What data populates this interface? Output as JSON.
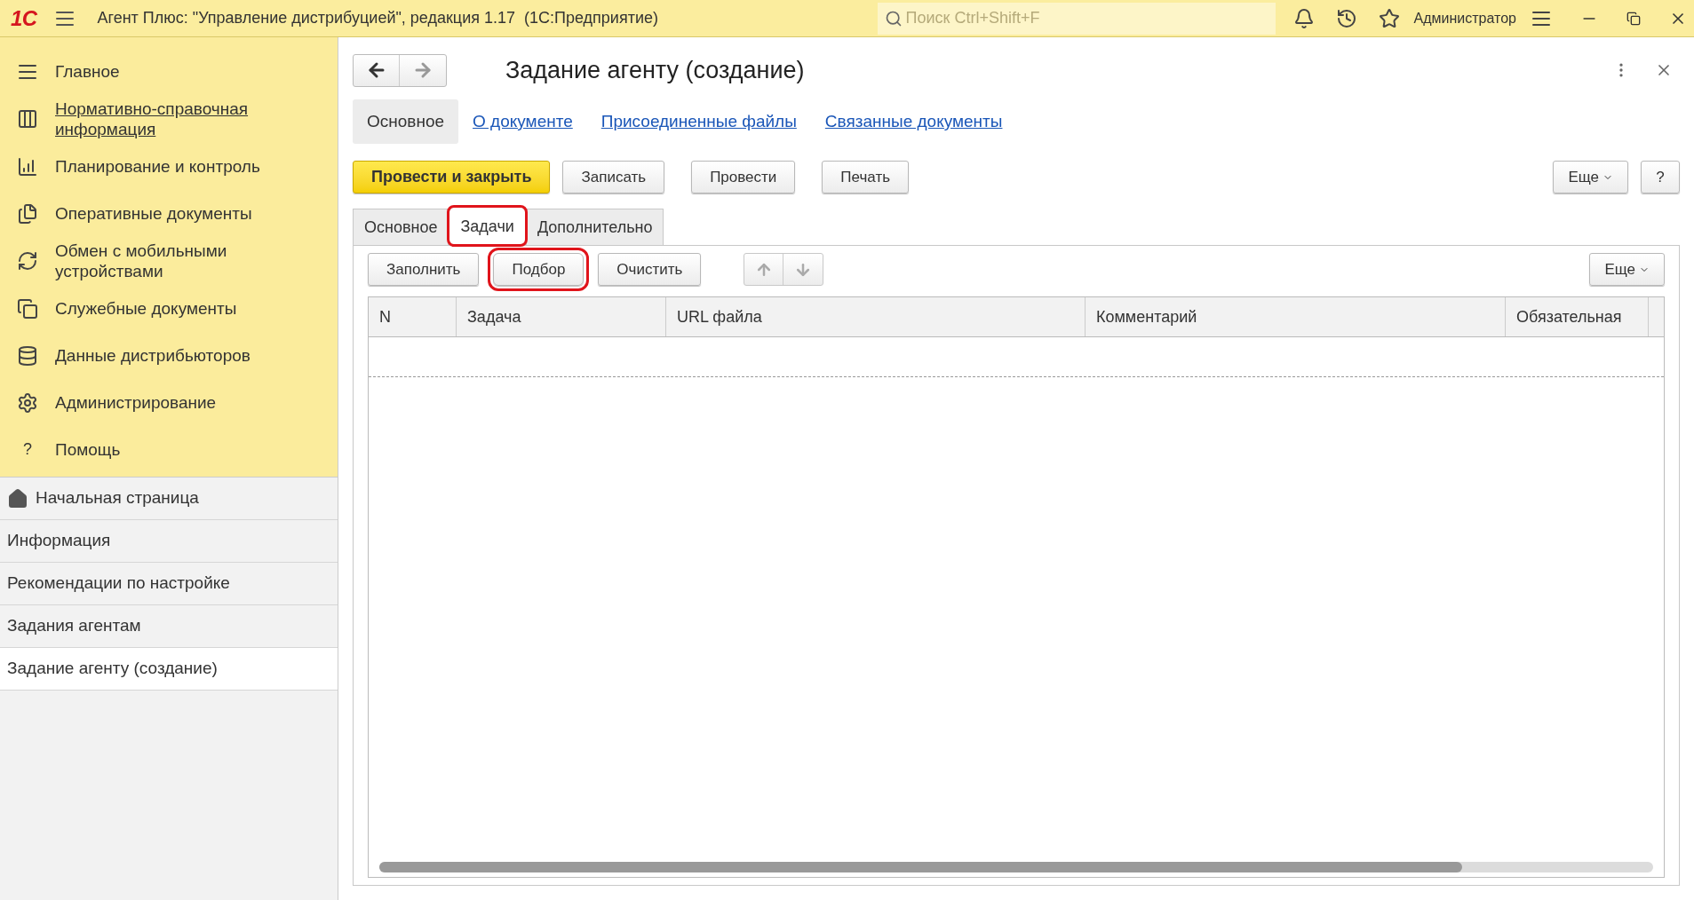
{
  "title_bar": {
    "logo": "1С",
    "title": "Агент Плюс: \"Управление дистрибуцией\", редакция 1.17  (1С:Предприятие)",
    "search": {
      "placeholder": "Поиск Ctrl+Shift+F"
    },
    "user": "Администратор"
  },
  "sidebar": {
    "sections": [
      {
        "label": "Главное",
        "link": false
      },
      {
        "label": "Нормативно-справочная информация",
        "link": true
      },
      {
        "label": "Планирование и контроль",
        "link": false
      },
      {
        "label": "Оперативные документы",
        "link": false
      },
      {
        "label": "Обмен с мобильными устройствами",
        "link": false
      },
      {
        "label": "Служебные документы",
        "link": false
      },
      {
        "label": "Данные дистрибьюторов",
        "link": false
      },
      {
        "label": "Администрирование",
        "link": false
      },
      {
        "label": "Помощь",
        "link": false,
        "glyph": "?"
      }
    ],
    "open_windows": [
      {
        "label": "Начальная страница",
        "selected": false,
        "home": true
      },
      {
        "label": "Информация",
        "selected": false,
        "home": false
      },
      {
        "label": "Рекомендации по настройке",
        "selected": false,
        "home": false
      },
      {
        "label": "Задания агентам",
        "selected": false,
        "home": false
      },
      {
        "label": "Задание агенту (создание)",
        "selected": true,
        "home": false
      }
    ]
  },
  "form": {
    "title": "Задание агенту (создание)",
    "nav_links": [
      {
        "label": "Основное",
        "selected": true
      },
      {
        "label": "О документе",
        "selected": false
      },
      {
        "label": "Присоединенные файлы",
        "selected": false
      },
      {
        "label": "Связанные документы",
        "selected": false
      }
    ],
    "commands": [
      {
        "label": "Провести и закрыть",
        "kind": "primary"
      },
      {
        "label": "Записать",
        "kind": "normal"
      },
      {
        "label": "Провести",
        "kind": "normal"
      },
      {
        "label": "Печать",
        "kind": "normal"
      }
    ],
    "more": "Еще",
    "help": "?",
    "tabs": [
      {
        "label": "Основное",
        "selected": false,
        "highlighted": false
      },
      {
        "label": "Задачи",
        "selected": true,
        "highlighted": true
      },
      {
        "label": "Дополнительно",
        "selected": false,
        "highlighted": false
      }
    ],
    "table_buttons": [
      {
        "label": "Заполнить",
        "highlighted": false
      },
      {
        "label": "Подбор",
        "highlighted": true
      },
      {
        "label": "Очистить",
        "highlighted": false
      }
    ],
    "table_more": "Еще",
    "table": {
      "columns": [
        "N",
        "Задача",
        "URL файла",
        "Комментарий",
        "Обязательная"
      ]
    }
  }
}
